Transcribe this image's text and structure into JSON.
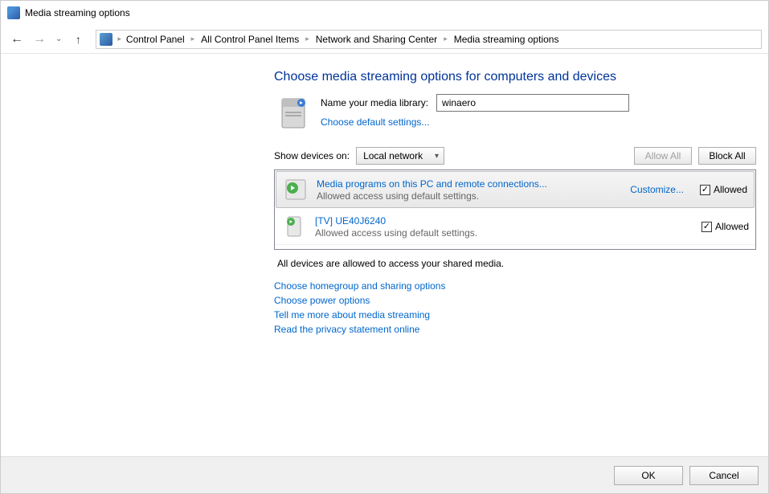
{
  "titlebar": {
    "title": "Media streaming options"
  },
  "breadcrumb": {
    "items": [
      "Control Panel",
      "All Control Panel Items",
      "Network and Sharing Center",
      "Media streaming options"
    ]
  },
  "main": {
    "heading": "Choose media streaming options for computers and devices",
    "library_label": "Name your media library:",
    "library_value": "winaero",
    "choose_default": "Choose default settings...",
    "show_devices_label": "Show devices on:",
    "show_devices_value": "Local network",
    "allow_all": "Allow All",
    "block_all": "Block All",
    "devices": [
      {
        "name": "Media programs on this PC and remote connections...",
        "status": "Allowed access using default settings.",
        "customize": "Customize...",
        "allowed_label": "Allowed",
        "selected": true
      },
      {
        "name": "[TV] UE40J6240",
        "status": "Allowed access using default settings.",
        "allowed_label": "Allowed",
        "selected": false
      }
    ],
    "summary": "All devices are allowed to access your shared media.",
    "links": [
      "Choose homegroup and sharing options",
      "Choose power options",
      "Tell me more about media streaming",
      "Read the privacy statement online"
    ]
  },
  "footer": {
    "ok": "OK",
    "cancel": "Cancel"
  }
}
